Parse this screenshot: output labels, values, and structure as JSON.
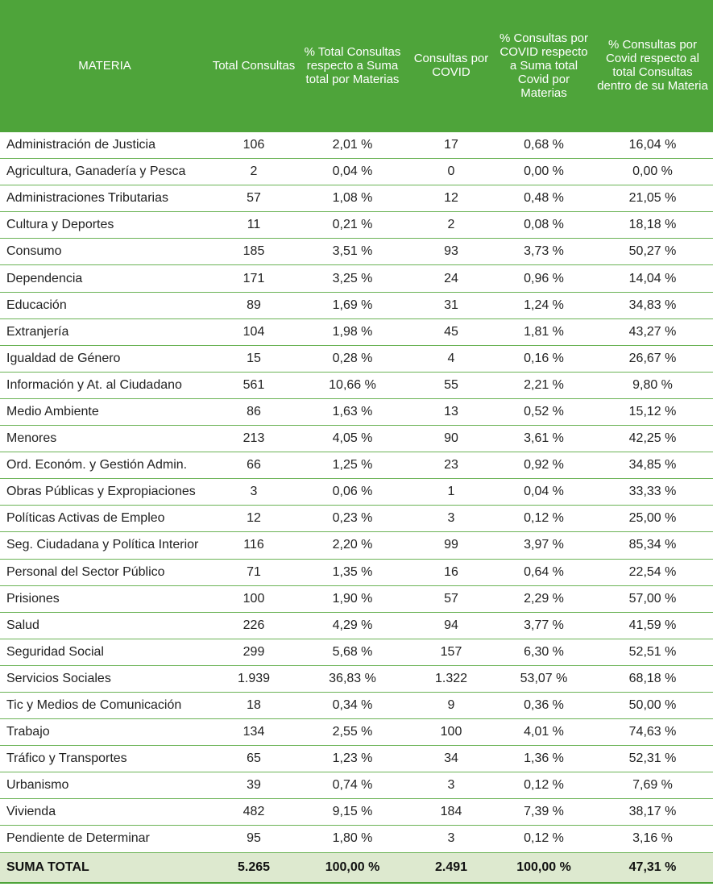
{
  "headers": {
    "materia": "MATERIA",
    "total": "Total Consultas",
    "pct_total": "% Total Consultas respecto a Suma total por Materias",
    "covid": "Consultas por COVID",
    "pct_covid": "% Consultas por COVID respecto a Suma total Covid por Materias",
    "pct_materia": "% Consultas por Covid respecto al total Consultas dentro de su Materia"
  },
  "rows": [
    [
      "Administración de Justicia",
      "106",
      "2,01 %",
      "17",
      "0,68 %",
      "16,04 %"
    ],
    [
      "Agricultura, Ganadería y Pesca",
      "2",
      "0,04 %",
      "0",
      "0,00 %",
      "0,00 %"
    ],
    [
      "Administraciones Tributarias",
      "57",
      "1,08 %",
      "12",
      "0,48 %",
      "21,05 %"
    ],
    [
      "Cultura y Deportes",
      "11",
      "0,21 %",
      "2",
      "0,08 %",
      "18,18 %"
    ],
    [
      "Consumo",
      "185",
      "3,51 %",
      "93",
      "3,73 %",
      "50,27 %"
    ],
    [
      "Dependencia",
      "171",
      "3,25 %",
      "24",
      "0,96 %",
      "14,04 %"
    ],
    [
      "Educación",
      "89",
      "1,69 %",
      "31",
      "1,24 %",
      "34,83 %"
    ],
    [
      "Extranjería",
      "104",
      "1,98 %",
      "45",
      "1,81 %",
      "43,27 %"
    ],
    [
      "Igualdad de Género",
      "15",
      "0,28 %",
      "4",
      "0,16 %",
      "26,67 %"
    ],
    [
      "Información y At. al Ciudadano",
      "561",
      "10,66 %",
      "55",
      "2,21 %",
      "9,80 %"
    ],
    [
      "Medio Ambiente",
      "86",
      "1,63 %",
      "13",
      "0,52 %",
      "15,12 %"
    ],
    [
      "Menores",
      "213",
      "4,05 %",
      "90",
      "3,61 %",
      "42,25 %"
    ],
    [
      "Ord. Económ. y Gestión Admin.",
      "66",
      "1,25 %",
      "23",
      "0,92 %",
      "34,85 %"
    ],
    [
      "Obras Públicas y Expropiaciones",
      "3",
      "0,06 %",
      "1",
      "0,04 %",
      "33,33 %"
    ],
    [
      "Políticas Activas de Empleo",
      "12",
      "0,23 %",
      "3",
      "0,12 %",
      "25,00 %"
    ],
    [
      "Seg. Ciudadana y Política Interior",
      "116",
      "2,20 %",
      "99",
      "3,97 %",
      "85,34 %"
    ],
    [
      "Personal del Sector Público",
      "71",
      "1,35 %",
      "16",
      "0,64 %",
      "22,54 %"
    ],
    [
      "Prisiones",
      "100",
      "1,90 %",
      "57",
      "2,29 %",
      "57,00 %"
    ],
    [
      "Salud",
      "226",
      "4,29 %",
      "94",
      "3,77 %",
      "41,59 %"
    ],
    [
      "Seguridad Social",
      "299",
      "5,68 %",
      "157",
      "6,30 %",
      "52,51 %"
    ],
    [
      "Servicios Sociales",
      "1.939",
      "36,83 %",
      "1.322",
      "53,07 %",
      "68,18 %"
    ],
    [
      "Tic y Medios de Comunicación",
      "18",
      "0,34 %",
      "9",
      "0,36 %",
      "50,00 %"
    ],
    [
      "Trabajo",
      "134",
      "2,55 %",
      "100",
      "4,01 %",
      "74,63 %"
    ],
    [
      "Tráfico y Transportes",
      "65",
      "1,23 %",
      "34",
      "1,36 %",
      "52,31 %"
    ],
    [
      "Urbanismo",
      "39",
      "0,74 %",
      "3",
      "0,12 %",
      "7,69 %"
    ],
    [
      "Vivienda",
      "482",
      "9,15 %",
      "184",
      "7,39 %",
      "38,17 %"
    ],
    [
      "Pendiente de Determinar",
      "95",
      "1,80 %",
      "3",
      "0,12 %",
      "3,16 %"
    ]
  ],
  "total_row": [
    "SUMA TOTAL",
    "5.265",
    "100,00 %",
    "2.491",
    "100,00 %",
    "47,31 %"
  ],
  "colors": {
    "header_bg": "#4ea43a",
    "row_rule": "#6bb356",
    "total_bg": "#dde9cf"
  }
}
